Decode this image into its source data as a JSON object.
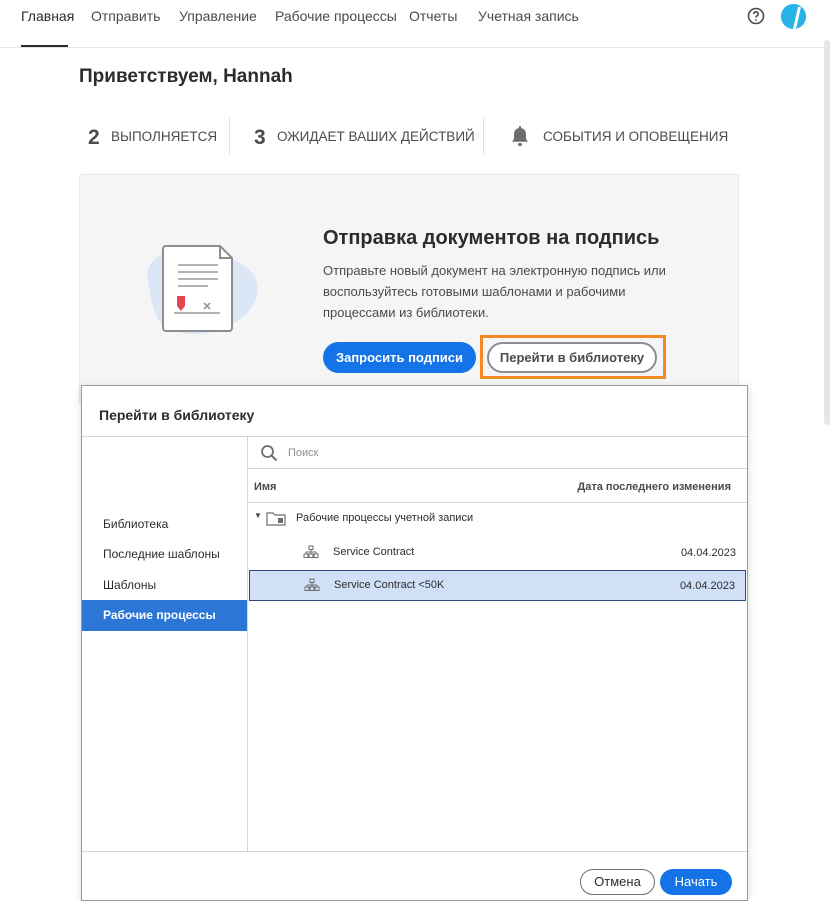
{
  "nav": {
    "tabs": [
      "Главная",
      "Отправить",
      "Управление",
      "Рабочие процессы",
      "Отчеты",
      "Учетная запись"
    ],
    "active_tab": "Главная",
    "help_icon": "question-circle-icon",
    "avatar_icon": "user-avatar-icon"
  },
  "welcome": "Приветствуем, Hannah",
  "stats": {
    "in_progress_count": "2",
    "in_progress_label": "ВЫПОЛНЯЕТСЯ",
    "waiting_count": "3",
    "waiting_label": "ОЖИДАЕТ ВАШИХ ДЕЙСТВИЙ",
    "events_icon": "bell-icon",
    "events_label": "СОБЫТИЯ И ОПОВЕЩЕНИЯ"
  },
  "card": {
    "title": "Отправка документов на подпись",
    "description": "Отправьте новый документ на электронную подпись или воспользуйтесь готовыми шаблонами и рабочими процессами из библиотеки.",
    "primary_button": "Запросить подписи",
    "library_button": "Перейти в библиотеку"
  },
  "dialog": {
    "title": "Перейти в библиотеку",
    "sidebar": [
      "Библиотека",
      "Последние шаблоны",
      "Шаблоны",
      "Рабочие процессы"
    ],
    "sidebar_selected": "Рабочие процессы",
    "search_placeholder": "Поиск",
    "columns": {
      "name": "Имя",
      "date": "Дата последнего изменения"
    },
    "folder": "Рабочие процессы учетной записи",
    "rows": [
      {
        "name": "Service Contract",
        "date": "04.04.2023",
        "selected": false
      },
      {
        "name": "Service Contract <50K",
        "date": "04.04.2023",
        "selected": true
      }
    ],
    "cancel_button": "Отмена",
    "start_button": "Начать"
  },
  "colors": {
    "accent_blue": "#1473e6",
    "sidebar_selected": "#2b76d6",
    "row_selected": "#cfe0f7",
    "highlight_orange": "#f08a24"
  }
}
